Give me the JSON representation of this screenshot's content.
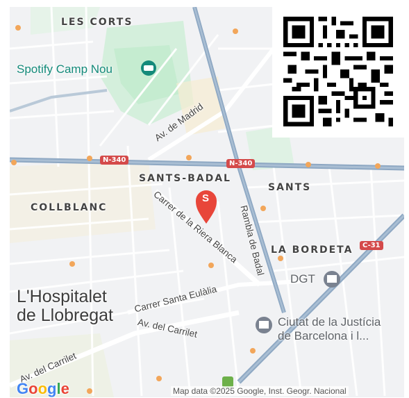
{
  "map": {
    "districts": [
      "LES CORTS",
      "SANTS-BADAL",
      "SANTS",
      "COLLBLANC",
      "LA BORDETA"
    ],
    "streets": [
      "Av. de Madrid",
      "Carrer de la Riera Blanca",
      "Rambla de Badal",
      "Carrer Santa Eulàlia",
      "Av. del Carrilet",
      "Av. del Carrilet"
    ],
    "road_shields": [
      "N-340",
      "N-340",
      "C-31"
    ],
    "city": "L'Hospitalet\nde Llobregat",
    "city_line1": "L'Hospitalet",
    "city_line2": "de Llobregat",
    "pois": {
      "stadium": "Spotify Camp Nou",
      "dgt": "DGT",
      "justice_line1": "Ciutat de la Justícia",
      "justice_line2": "de Barcelona i l..."
    },
    "marker_letter": "S",
    "attribution": "Map data ©2025 Google, Inst. Geogr. Nacional",
    "logo": "Google",
    "colors": {
      "base": "#f1f2f4",
      "park": "#c5ecd0",
      "highway": "#8ea8c3",
      "marker": "#e8463a",
      "shield": "#d44a4a",
      "teal_poi": "#148a7a"
    }
  },
  "qr_code": {
    "icon": "qr-code-icon"
  }
}
